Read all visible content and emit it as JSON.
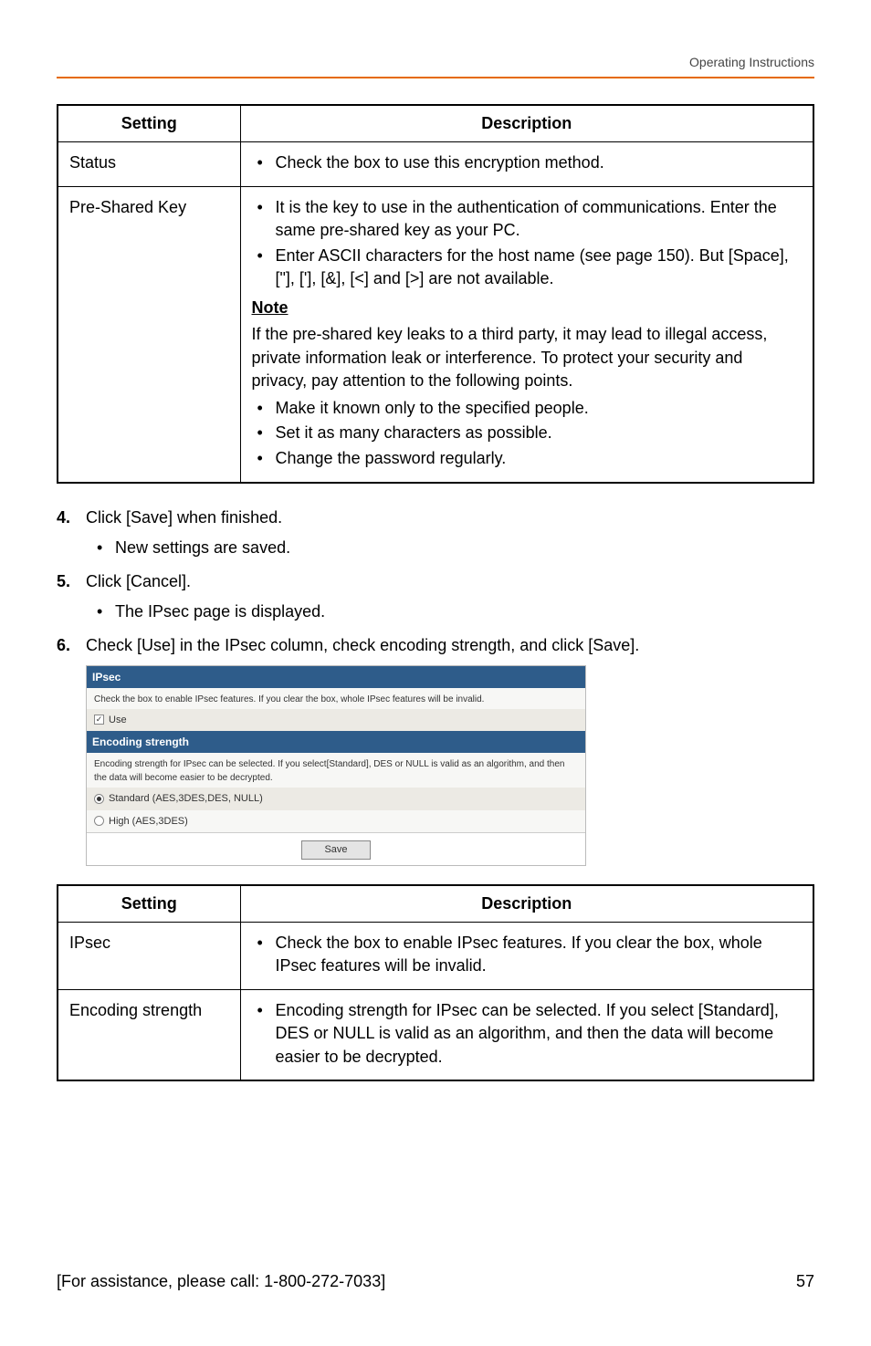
{
  "header": {
    "title": "Operating Instructions"
  },
  "table1": {
    "head_setting": "Setting",
    "head_desc": "Description",
    "rows": {
      "status": {
        "label": "Status",
        "bullet": "Check the box to use this encryption method."
      },
      "psk": {
        "label": "Pre-Shared Key",
        "b1": "It is the key to use in the authentication of communications. Enter the same pre-shared key as your PC.",
        "b2": "Enter ASCII characters for the host name (see page 150). But [Space], [\"], ['], [&], [<] and [>] are not available.",
        "note_hd": "Note",
        "note_p": "If the pre-shared key leaks to a third party, it may lead to illegal access, private information leak or interference. To protect your security and privacy, pay attention to the following points.",
        "nb1": "Make it known only to the specified people.",
        "nb2": "Set it as many characters as possible.",
        "nb3": "Change the password regularly."
      }
    }
  },
  "steps": {
    "s4": {
      "num": "4.",
      "text": "Click [Save] when finished.",
      "sub": "New settings are saved."
    },
    "s5": {
      "num": "5.",
      "text": "Click [Cancel].",
      "sub": "The IPsec page is displayed."
    },
    "s6": {
      "num": "6.",
      "text": "Check [Use] in the IPsec column, check encoding strength, and click [Save]."
    }
  },
  "panel": {
    "ipsec_head": "IPsec",
    "ipsec_desc": "Check the box to enable IPsec features. If you clear the box, whole IPsec features will be invalid.",
    "use_label": "Use",
    "enc_head": "Encoding strength",
    "enc_desc": "Encoding strength for IPsec can be selected. If you select[Standard], DES or NULL is valid as an algorithm, and then the data will become easier to be decrypted.",
    "opt_std": "Standard (AES,3DES,DES, NULL)",
    "opt_high": "High (AES,3DES)",
    "save": "Save"
  },
  "table2": {
    "head_setting": "Setting",
    "head_desc": "Description",
    "rows": {
      "ipsec": {
        "label": "IPsec",
        "bullet": "Check the box to enable IPsec features. If you clear the box, whole IPsec features will be invalid."
      },
      "enc": {
        "label": "Encoding strength",
        "bullet": "Encoding strength for IPsec can be selected. If you select [Standard], DES or NULL is valid as an algorithm, and then the data will become easier to be decrypted."
      }
    }
  },
  "footer": {
    "assist": "[For assistance, please call: 1-800-272-7033]",
    "page": "57"
  }
}
